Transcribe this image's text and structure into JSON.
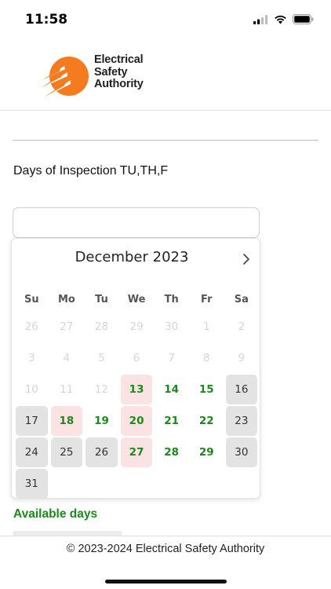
{
  "status_bar": {
    "time": "11:58"
  },
  "header": {
    "logo_lines": [
      "Electrical",
      "Safety",
      "Authority"
    ],
    "brand_color": "#F47B20"
  },
  "form": {
    "days_label": "Days of Inspection TU,TH,F",
    "date_input_value": "",
    "date_input_placeholder": ""
  },
  "calendar": {
    "month_title": "December 2023",
    "weekdays": [
      "Su",
      "Mo",
      "Tu",
      "We",
      "Th",
      "Fr",
      "Sa"
    ],
    "days": [
      {
        "label": "26",
        "state": "muted"
      },
      {
        "label": "27",
        "state": "muted"
      },
      {
        "label": "28",
        "state": "muted"
      },
      {
        "label": "29",
        "state": "muted"
      },
      {
        "label": "30",
        "state": "muted"
      },
      {
        "label": "1",
        "state": "muted"
      },
      {
        "label": "2",
        "state": "muted"
      },
      {
        "label": "3",
        "state": "muted"
      },
      {
        "label": "4",
        "state": "muted"
      },
      {
        "label": "5",
        "state": "muted"
      },
      {
        "label": "6",
        "state": "muted"
      },
      {
        "label": "7",
        "state": "muted"
      },
      {
        "label": "8",
        "state": "muted"
      },
      {
        "label": "9",
        "state": "muted"
      },
      {
        "label": "10",
        "state": "muted"
      },
      {
        "label": "11",
        "state": "muted"
      },
      {
        "label": "12",
        "state": "muted"
      },
      {
        "label": "13",
        "state": "available-highlight"
      },
      {
        "label": "14",
        "state": "available"
      },
      {
        "label": "15",
        "state": "available"
      },
      {
        "label": "16",
        "state": "unavailable"
      },
      {
        "label": "17",
        "state": "unavailable"
      },
      {
        "label": "18",
        "state": "available-highlight"
      },
      {
        "label": "19",
        "state": "available"
      },
      {
        "label": "20",
        "state": "available-highlight"
      },
      {
        "label": "21",
        "state": "available"
      },
      {
        "label": "22",
        "state": "available"
      },
      {
        "label": "23",
        "state": "unavailable"
      },
      {
        "label": "24",
        "state": "unavailable"
      },
      {
        "label": "25",
        "state": "unavailable"
      },
      {
        "label": "26",
        "state": "unavailable"
      },
      {
        "label": "27",
        "state": "available-highlight"
      },
      {
        "label": "28",
        "state": "available"
      },
      {
        "label": "29",
        "state": "available"
      },
      {
        "label": "30",
        "state": "unavailable"
      },
      {
        "label": "31",
        "state": "unavailable"
      }
    ],
    "colors": {
      "available": "#1A8A1A",
      "highlight_bg": "#FBE3E3",
      "unavailable_bg": "#E3E3E3"
    }
  },
  "legend": {
    "available_label": "Available days"
  },
  "footer": {
    "copyright": "© 2023-2024 Electrical Safety Authority"
  }
}
